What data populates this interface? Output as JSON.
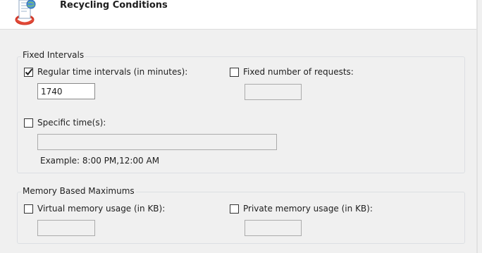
{
  "header": {
    "title": "Recycling Conditions",
    "icon": "recycle-document-icon"
  },
  "fixed_intervals": {
    "legend": "Fixed Intervals",
    "regular_time": {
      "label": "Regular time intervals (in minutes):",
      "checked": true,
      "value": "1740"
    },
    "fixed_requests": {
      "label": "Fixed number of requests:",
      "checked": false,
      "value": ""
    },
    "specific_times": {
      "label": "Specific time(s):",
      "checked": false,
      "value": "",
      "example": "Example: 8:00 PM,12:00 AM"
    }
  },
  "memory_maximums": {
    "legend": "Memory Based Maximums",
    "virtual_memory": {
      "label": "Virtual memory usage (in KB):",
      "checked": false,
      "value": ""
    },
    "private_memory": {
      "label": "Private memory usage (in KB):",
      "checked": false,
      "value": ""
    }
  },
  "colors": {
    "window_bg": "#f0f0f0",
    "header_bg": "#ffffff",
    "group_border": "#dcdfe3",
    "checkmark": "#1e1e1e"
  }
}
